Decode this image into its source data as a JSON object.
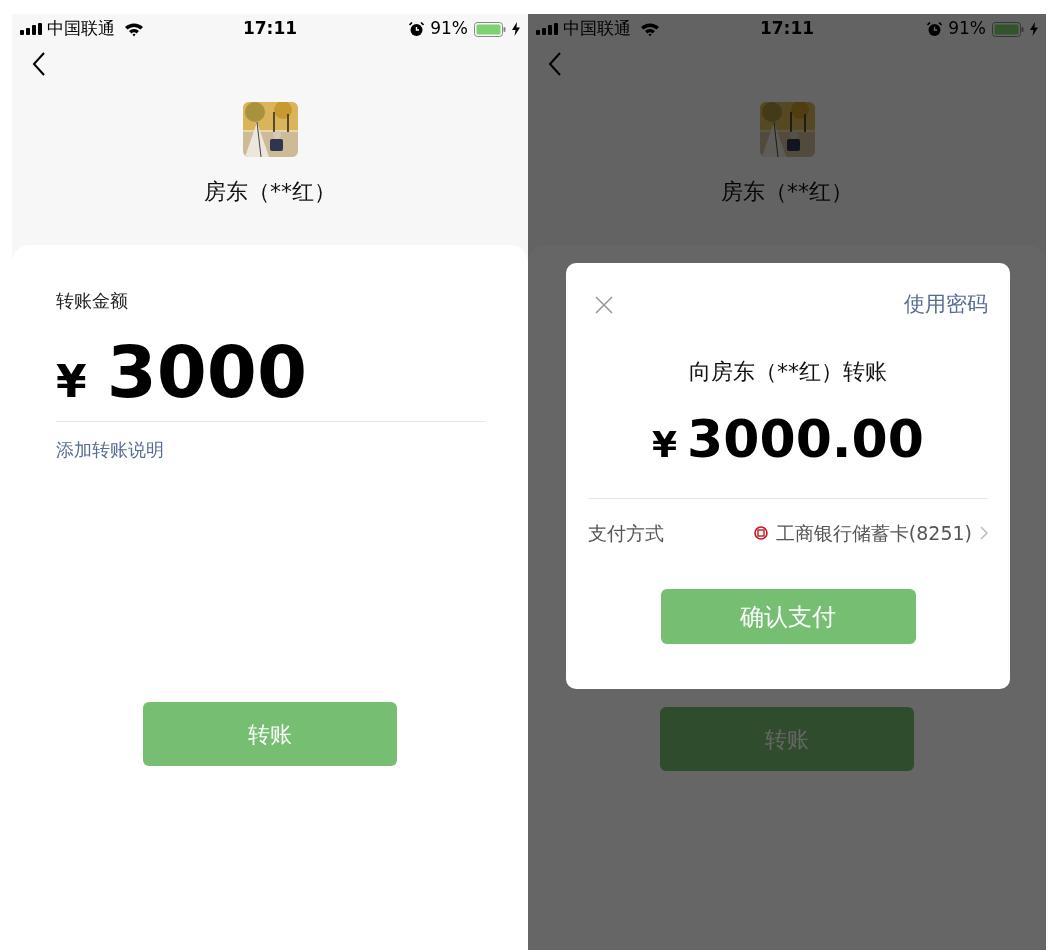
{
  "screens": [
    {
      "dimmed": false,
      "status_bar": {
        "carrier": "中国联通",
        "time": "17:11",
        "battery": "91%"
      },
      "recipient": {
        "name": "房东（**红）"
      },
      "amount_label": "转账金额",
      "currency": "¥",
      "amount": "3000",
      "note_link": "添加转账说明",
      "submit_button": "转账"
    },
    {
      "dimmed": true,
      "status_bar": {
        "carrier": "中国联通",
        "time": "17:11",
        "battery": "91%"
      },
      "recipient": {
        "name": "房东（**红）"
      },
      "submit_button": "转账",
      "dialog": {
        "password_link": "使用密码",
        "title": "向房东（**红）转账",
        "currency": "¥",
        "amount": "3000.00",
        "payment_label": "支付方式",
        "payment_method": "工商银行储蓄卡(8251)",
        "confirm_button": "确认支付"
      }
    }
  ]
}
